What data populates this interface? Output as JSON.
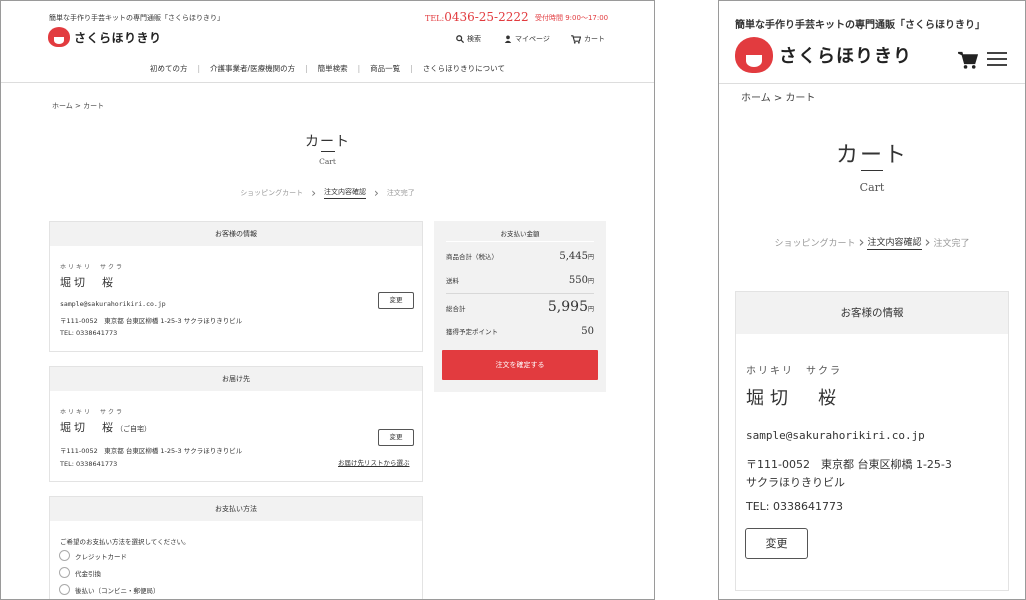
{
  "site": {
    "tagline": "簡単な手作り手芸キットの専門通販「さくらほりきり」",
    "logo_text": "さくらほりきり",
    "phone_prefix": "TEL:",
    "phone": "0436-25-2222",
    "hours": "受付時間 9:00～17:00",
    "util": {
      "search": "検索",
      "mypage": "マイページ",
      "cart": "カート"
    },
    "nav": [
      "初めての方",
      "介護事業者/医療機関の方",
      "簡単検索",
      "商品一覧",
      "さくらほりきりについて"
    ]
  },
  "breadcrumb": "ホーム > カート",
  "page": {
    "title": "カート",
    "subtitle": "Cart"
  },
  "steps": {
    "s1": "ショッピングカート",
    "s2": "注文内容確認",
    "s3": "注文完了"
  },
  "customer": {
    "heading": "お客様の情報",
    "kana": "ホリキリ　サクラ",
    "name": "堀切　桜",
    "email": "sample@sakurahorikiri.co.jp",
    "address": "〒111-0052　東京都 台東区柳橋 1-25-3 サクラほりきりビル",
    "address_line1": "〒111-0052　東京都 台東区柳橋 1-25-3",
    "address_line2": "サクラほりきりビル",
    "tel": "TEL: 0338641773",
    "change_label": "変更"
  },
  "delivery": {
    "heading": "お届け先",
    "kana": "ホリキリ　サクラ",
    "name": "堀切　桜",
    "name_note": "（ご自宅）",
    "address": "〒111-0052　東京都 台東区柳橋 1-25-3 サクラほりきりビル",
    "tel": "TEL: 0338641773",
    "change_label": "変更",
    "list_link": "お届け先リストから選ぶ"
  },
  "payment_method": {
    "heading": "お支払い方法",
    "prompt": "ご希望のお支払い方法を選択してください。",
    "options": [
      "クレジットカード",
      "代金引換",
      "後払い（コンビニ・郵便局）"
    ]
  },
  "payment_summary": {
    "heading": "お支払い金額",
    "subtotal_label": "商品合計（税込）",
    "subtotal": "5,445",
    "shipping_label": "送料",
    "shipping": "550",
    "total_label": "総合計",
    "total": "5,995",
    "yen": "円",
    "points_label": "獲得予定ポイント",
    "points": "50",
    "confirm_label": "注文を確定する"
  },
  "colors": {
    "brand_red": "#e23b3f",
    "panel_gray": "#f2f2f2"
  }
}
